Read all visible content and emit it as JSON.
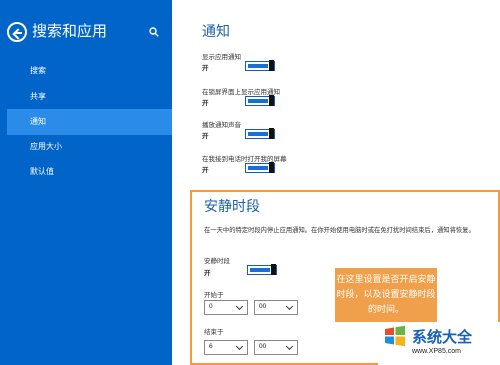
{
  "sidebar": {
    "title": "搜索和应用",
    "items": [
      {
        "label": "搜索"
      },
      {
        "label": "共享"
      },
      {
        "label": "通知"
      },
      {
        "label": "应用大小"
      },
      {
        "label": "默认值"
      }
    ],
    "selected_index": 2
  },
  "notifications": {
    "title": "通知",
    "settings": [
      {
        "label": "显示应用通知",
        "value": "开"
      },
      {
        "label": "在锁屏界面上显示应用通知",
        "value": "开"
      },
      {
        "label": "播放通知声音",
        "value": "开"
      },
      {
        "label": "在我接到电话时打开我的屏幕",
        "value": "开"
      }
    ]
  },
  "quiet_hours": {
    "title": "安静时段",
    "description": "在一天中的特定时段内停止应用通知。在你开始使用电脑时或在免打扰时间结束后，通知将恢复。",
    "toggle_label": "安静时段",
    "toggle_value": "开",
    "start_label": "开始于",
    "start_hour": "0",
    "start_minute": "00",
    "end_label": "结束于",
    "end_hour": "6",
    "end_minute": "00"
  },
  "callout": {
    "line1": "在这里设置是否开启安静",
    "line2": "时段，以及设置安静时段",
    "line3": "的时间。"
  },
  "watermark": {
    "text": "系统大全",
    "url": "www.XP85.com"
  },
  "colors": {
    "sidebar": "#0064c8",
    "selected": "#2a8be8",
    "accent": "#1670d6",
    "callout": "#f0a04a",
    "box_border": "#f29b3c"
  }
}
